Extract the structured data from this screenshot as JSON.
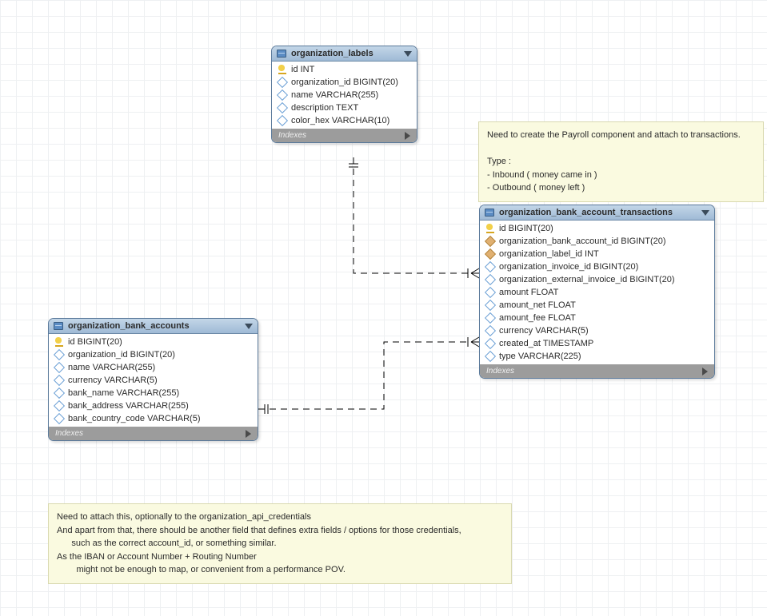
{
  "tables": {
    "labels": {
      "title": "organization_labels",
      "cols": [
        {
          "icon": "pk",
          "text": "id INT"
        },
        {
          "icon": "attr",
          "text": "organization_id BIGINT(20)"
        },
        {
          "icon": "attr",
          "text": "name VARCHAR(255)"
        },
        {
          "icon": "attr",
          "text": "description TEXT"
        },
        {
          "icon": "attr",
          "text": "color_hex VARCHAR(10)"
        }
      ]
    },
    "accounts": {
      "title": "organization_bank_accounts",
      "cols": [
        {
          "icon": "pk",
          "text": "id BIGINT(20)"
        },
        {
          "icon": "attr",
          "text": "organization_id BIGINT(20)"
        },
        {
          "icon": "attr",
          "text": "name VARCHAR(255)"
        },
        {
          "icon": "attr",
          "text": "currency VARCHAR(5)"
        },
        {
          "icon": "attr",
          "text": "bank_name VARCHAR(255)"
        },
        {
          "icon": "attr",
          "text": "bank_address VARCHAR(255)"
        },
        {
          "icon": "attr",
          "text": "bank_country_code VARCHAR(5)"
        }
      ]
    },
    "transactions": {
      "title": "organization_bank_account_transactions",
      "cols": [
        {
          "icon": "pk",
          "text": "id BIGINT(20)"
        },
        {
          "icon": "fk",
          "text": "organization_bank_account_id BIGINT(20)"
        },
        {
          "icon": "fk",
          "text": "organization_label_id INT"
        },
        {
          "icon": "attr",
          "text": "organization_invoice_id BIGINT(20)"
        },
        {
          "icon": "attr",
          "text": "organization_external_invoice_id BIGINT(20)"
        },
        {
          "icon": "attr",
          "text": "amount FLOAT"
        },
        {
          "icon": "attr",
          "text": "amount_net FLOAT"
        },
        {
          "icon": "attr",
          "text": "amount_fee FLOAT"
        },
        {
          "icon": "attr",
          "text": "currency VARCHAR(5)"
        },
        {
          "icon": "attr",
          "text": "created_at TIMESTAMP"
        },
        {
          "icon": "attr",
          "text": "type VARCHAR(225)"
        }
      ]
    }
  },
  "indexes_label": "Indexes",
  "notes": {
    "top": {
      "lines": [
        "Need to create the Payroll component and attach to transactions.",
        "",
        "Type :",
        "- Inbound ( money came in )",
        "- Outbound ( money left )"
      ]
    },
    "bottom": {
      "lines": [
        "Need to attach this, optionally to the organization_api_credentials",
        "And apart from that, there should be another field that defines extra fields / options for those credentials,",
        "      such as the correct account_id, or something similar.",
        "As the IBAN or Account Number + Routing Number",
        "        might not be enough to map, or convenient from a performance POV."
      ]
    }
  }
}
